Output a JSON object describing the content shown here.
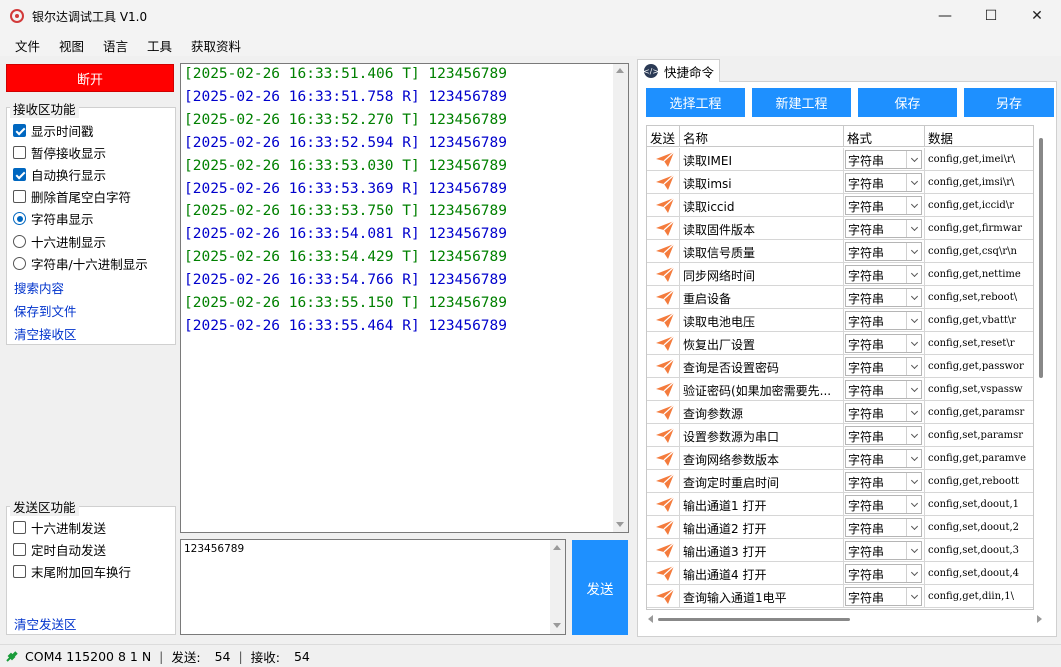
{
  "window": {
    "title": "银尔达调试工具 V1.0",
    "minimize": "—",
    "maximize": "☐",
    "close": "✕"
  },
  "menu": [
    "文件",
    "视图",
    "语言",
    "工具",
    "获取资料"
  ],
  "left": {
    "disconnect_label": "断开",
    "disconnect_color": "#ff0000",
    "recv_group": {
      "title": "接收区功能",
      "options": [
        {
          "label": "显示时间戳",
          "type": "checkbox",
          "checked": true
        },
        {
          "label": "暂停接收显示",
          "type": "checkbox",
          "checked": false
        },
        {
          "label": "自动换行显示",
          "type": "checkbox",
          "checked": true
        },
        {
          "label": "删除首尾空白字符",
          "type": "checkbox",
          "checked": false
        },
        {
          "label": "字符串显示",
          "type": "radio",
          "checked": true
        },
        {
          "label": "十六进制显示",
          "type": "radio",
          "checked": false
        },
        {
          "label": "字符串/十六进制显示",
          "type": "radio",
          "checked": false
        }
      ],
      "links": [
        "搜索内容",
        "保存到文件",
        "清空接收区"
      ]
    },
    "send_group": {
      "title": "发送区功能",
      "options": [
        {
          "label": "十六进制发送",
          "type": "checkbox",
          "checked": false
        },
        {
          "label": "定时自动发送",
          "type": "checkbox",
          "checked": false
        },
        {
          "label": "末尾附加回车换行",
          "type": "checkbox",
          "checked": false
        }
      ],
      "link": "清空发送区"
    }
  },
  "receive_log": [
    {
      "text": "[2025-02-26 16:33:51.406 T] 123456789",
      "dir": "T"
    },
    {
      "text": "[2025-02-26 16:33:51.758 R] 123456789",
      "dir": "R"
    },
    {
      "text": "[2025-02-26 16:33:52.270 T] 123456789",
      "dir": "T"
    },
    {
      "text": "[2025-02-26 16:33:52.594 R] 123456789",
      "dir": "R"
    },
    {
      "text": "[2025-02-26 16:33:53.030 T] 123456789",
      "dir": "T"
    },
    {
      "text": "[2025-02-26 16:33:53.369 R] 123456789",
      "dir": "R"
    },
    {
      "text": "[2025-02-26 16:33:53.750 T] 123456789",
      "dir": "T"
    },
    {
      "text": "[2025-02-26 16:33:54.081 R] 123456789",
      "dir": "R"
    },
    {
      "text": "[2025-02-26 16:33:54.429 T] 123456789",
      "dir": "T"
    },
    {
      "text": "[2025-02-26 16:33:54.766 R] 123456789",
      "dir": "R"
    },
    {
      "text": "[2025-02-26 16:33:55.150 T] 123456789",
      "dir": "T"
    },
    {
      "text": "[2025-02-26 16:33:55.464 R] 123456789",
      "dir": "R"
    }
  ],
  "colors": {
    "tx": "#008000",
    "rx": "#0000cc",
    "accent": "#1e90ff"
  },
  "send": {
    "text": "123456789",
    "button_label": "发送"
  },
  "quick": {
    "tab_label": "快捷命令",
    "tab_icon": "code-icon",
    "buttons": [
      "选择工程",
      "新建工程",
      "保存",
      "另存"
    ],
    "headers": [
      "发送",
      "名称",
      "格式",
      "数据"
    ],
    "rows": [
      {
        "name": "读取IMEI",
        "format": "字符串",
        "data": "config,get,imei\\r\\"
      },
      {
        "name": "读取imsi",
        "format": "字符串",
        "data": "config,get,imsi\\r\\"
      },
      {
        "name": "读取iccid",
        "format": "字符串",
        "data": "config,get,iccid\\r"
      },
      {
        "name": "读取固件版本",
        "format": "字符串",
        "data": "config,get,firmwar"
      },
      {
        "name": "读取信号质量",
        "format": "字符串",
        "data": "config,get,csq\\r\\n"
      },
      {
        "name": "同步网络时间",
        "format": "字符串",
        "data": "config,get,nettime"
      },
      {
        "name": "重启设备",
        "format": "字符串",
        "data": "config,set,reboot\\"
      },
      {
        "name": "读取电池电压",
        "format": "字符串",
        "data": "config,get,vbatt\\r"
      },
      {
        "name": "恢复出厂设置",
        "format": "字符串",
        "data": "config,set,reset\\r"
      },
      {
        "name": "查询是否设置密码",
        "format": "字符串",
        "data": "config,get,passwor"
      },
      {
        "name": "验证密码(如果加密需要先...",
        "format": "字符串",
        "data": "config,set,vspassw"
      },
      {
        "name": "查询参数源",
        "format": "字符串",
        "data": "config,get,paramsr"
      },
      {
        "name": "设置参数源为串口",
        "format": "字符串",
        "data": "config,set,paramsr"
      },
      {
        "name": "查询网络参数版本",
        "format": "字符串",
        "data": "config,get,paramve"
      },
      {
        "name": "查询定时重启时间",
        "format": "字符串",
        "data": "config,get,reboott"
      },
      {
        "name": "输出通道1 打开",
        "format": "字符串",
        "data": "config,set,doout,1"
      },
      {
        "name": "输出通道2 打开",
        "format": "字符串",
        "data": "config,set,doout,2"
      },
      {
        "name": "输出通道3 打开",
        "format": "字符串",
        "data": "config,set,doout,3"
      },
      {
        "name": "输出通道4 打开",
        "format": "字符串",
        "data": "config,set,doout,4"
      },
      {
        "name": "查询输入通道1电平",
        "format": "字符串",
        "data": "config,get,diin,1\\"
      }
    ]
  },
  "status": {
    "port": "COM4 115200 8 1 N",
    "sent_label": "发送:",
    "sent_count": "54",
    "recv_label": "接收:",
    "recv_count": "54",
    "sep": "|"
  }
}
